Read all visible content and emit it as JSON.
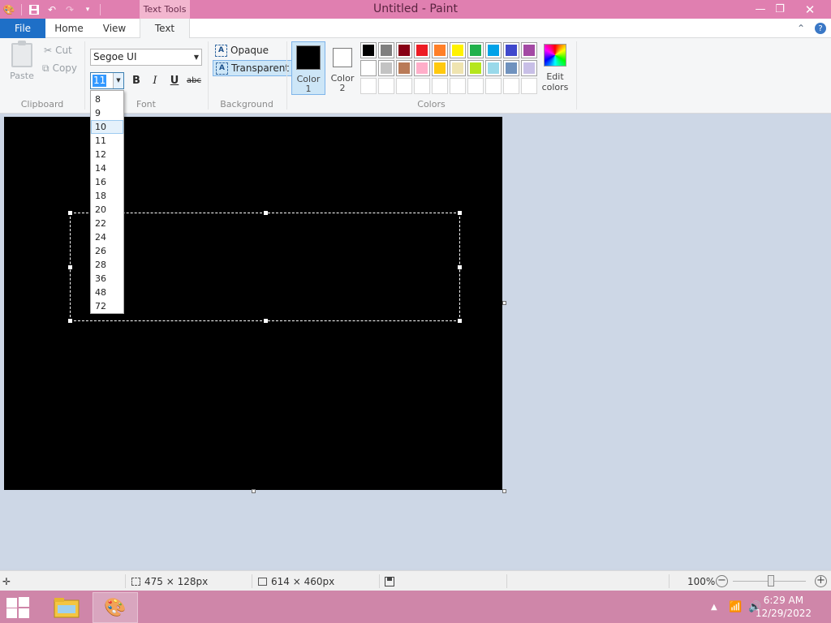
{
  "window": {
    "title": "Untitled - Paint"
  },
  "qat": {
    "icons": [
      "paint-app-icon",
      "save-icon",
      "undo-icon",
      "redo-icon",
      "customize-qat-icon"
    ]
  },
  "ribbon_tabs": {
    "context_header": "Text Tools",
    "file": "File",
    "home": "Home",
    "view": "View",
    "text": "Text"
  },
  "clipboard": {
    "paste": "Paste",
    "cut": "Cut",
    "copy": "Copy",
    "label": "Clipboard"
  },
  "font": {
    "family": "Segoe UI",
    "size": "11",
    "bold": "B",
    "italic": "I",
    "underline": "U",
    "strikethrough": "abc",
    "label": "Font",
    "size_options": [
      "8",
      "9",
      "10",
      "11",
      "12",
      "14",
      "16",
      "18",
      "20",
      "22",
      "24",
      "26",
      "28",
      "36",
      "48",
      "72"
    ],
    "hovered_option": "10"
  },
  "background": {
    "opaque": "Opaque",
    "transparent": "Transparent",
    "label": "Background",
    "selected": "transparent"
  },
  "colors": {
    "color1_label_a": "Color",
    "color1_label_b": "1",
    "color2_label_a": "Color",
    "color2_label_b": "2",
    "color1": "#000000",
    "color2": "#ffffff",
    "edit_a": "Edit",
    "edit_b": "colors",
    "label": "Colors",
    "palette": [
      [
        "#000000",
        "#7f7f7f",
        "#880015",
        "#ed1c24",
        "#ff7f27",
        "#fff200",
        "#22b14c",
        "#00a2e8",
        "#3f48cc",
        "#a349a4"
      ],
      [
        "#ffffff",
        "#c3c3c3",
        "#b97a57",
        "#ffaec9",
        "#ffc90e",
        "#efe4b0",
        "#b5e61d",
        "#99d9ea",
        "#7092be",
        "#c8bfe7"
      ],
      [
        "",
        "",
        "",
        "",
        "",
        "",
        "",
        "",
        "",
        ""
      ]
    ]
  },
  "status": {
    "selection_size": "475 × 128px",
    "canvas_size": "614 × 460px",
    "zoom": "100%"
  },
  "taskbar": {
    "time": "6:29 AM",
    "date": "12/29/2022"
  }
}
